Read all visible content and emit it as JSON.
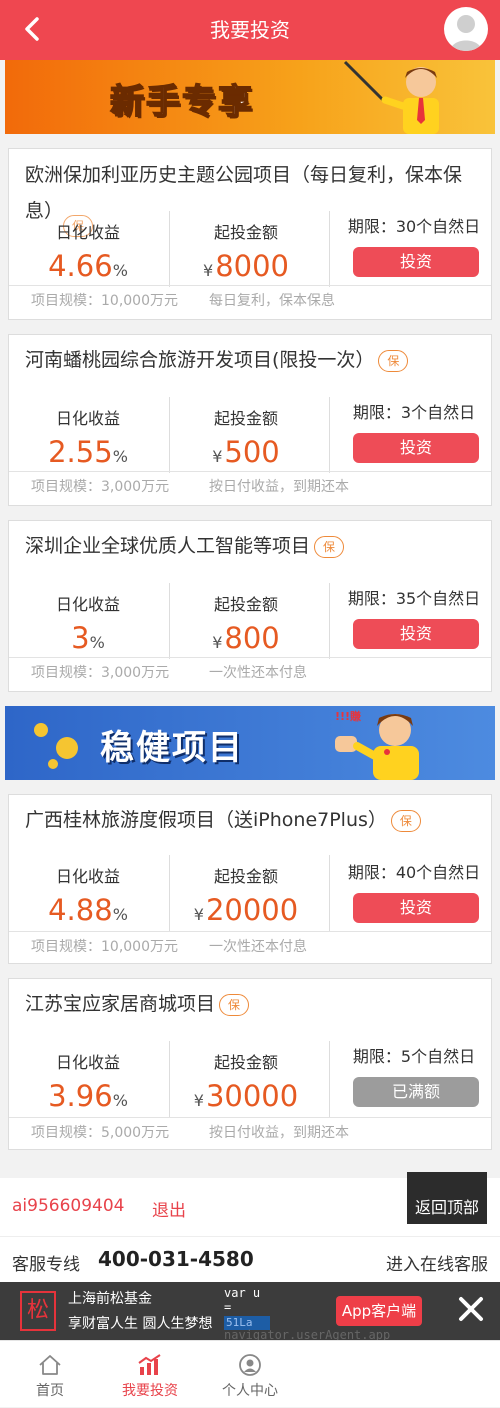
{
  "header": {
    "title": "我要投资"
  },
  "banners": {
    "newbie": "新手专享",
    "stable": "稳健项目",
    "stable_badge": "!!!賺"
  },
  "labels": {
    "rate": "日化收益",
    "min": "起投金额",
    "percent_unit": "%",
    "currency": "¥",
    "guarantee": "保"
  },
  "projects": [
    {
      "name": "欧洲保加利亚历史主题公园项目（每日复利，保本保息）",
      "rate": "4.66",
      "min": "8000",
      "term": "期限：30个自然日",
      "button": "投资",
      "scale": "项目规模：10,000万元",
      "method": "每日复利，保本保息"
    },
    {
      "name": "河南蟠桃园综合旅游开发项目(限投一次）",
      "rate": "2.55",
      "min": "500",
      "term": "期限：3个自然日",
      "button": "投资",
      "scale": "项目规模：3,000万元",
      "method": "按日付收益，到期还本"
    },
    {
      "name": "深圳企业全球优质人工智能等项目",
      "rate": "3",
      "min": "800",
      "term": "期限：35个自然日",
      "button": "投资",
      "scale": "项目规模：3,000万元",
      "method": "一次性还本付息"
    },
    {
      "name": "广西桂林旅游度假项目（送iPhone7Plus）",
      "rate": "4.88",
      "min": "20000",
      "term": "期限：40个自然日",
      "button": "投资",
      "scale": "项目规模：10,000万元",
      "method": "一次性还本付息"
    },
    {
      "name": "江苏宝应家居商城项目",
      "rate": "3.96",
      "min": "30000",
      "term": "期限：5个自然日",
      "button": "已满额",
      "scale": "项目规模：5,000万元",
      "method": "按日付收益，到期还本"
    }
  ],
  "user": {
    "account": "ai956609404",
    "logout": "退出",
    "back_to_top": "返回顶部"
  },
  "service": {
    "label": "客服专线",
    "phone": "400-031-4580",
    "online": "进入在线客服"
  },
  "appbar": {
    "logo_text": "松",
    "company": "上海前松基金",
    "slogan": "享财富人生 圆人生梦想",
    "code_line": "var u =",
    "code_badge": "51La",
    "code_tail": "navigator.userAgent.app",
    "app_button": "App客户端"
  },
  "tabs": [
    {
      "label": "首页",
      "icon": "home-icon",
      "active": false
    },
    {
      "label": "我要投资",
      "icon": "chart-icon",
      "active": true
    },
    {
      "label": "个人中心",
      "icon": "user-icon",
      "active": false
    }
  ],
  "colors": {
    "brand": "#ef4750",
    "accent": "#e65a22",
    "disabled": "#9c9c9c"
  }
}
